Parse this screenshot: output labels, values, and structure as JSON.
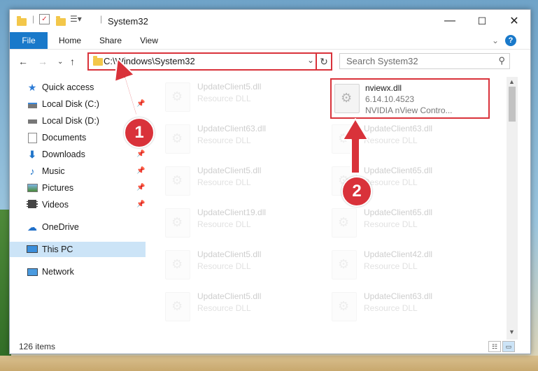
{
  "window": {
    "title": "System32",
    "controls": {
      "minimize": "—",
      "maximize": "☐",
      "close": "✕"
    }
  },
  "ribbon": {
    "tabs": [
      "File",
      "Home",
      "Share",
      "View"
    ],
    "help": "?"
  },
  "navigation": {
    "address": "C:\\Windows\\System32",
    "search_placeholder": "Search System32"
  },
  "sidebar": {
    "items": [
      {
        "label": "Quick access",
        "icon": "star-icon",
        "pinned": false
      },
      {
        "label": "Local Disk (C:)",
        "icon": "drive-icon",
        "pinned": true
      },
      {
        "label": "Local Disk (D:)",
        "icon": "drive-icon",
        "pinned": false
      },
      {
        "label": "Documents",
        "icon": "documents-icon",
        "pinned": true
      },
      {
        "label": "Downloads",
        "icon": "download-icon",
        "pinned": true
      },
      {
        "label": "Music",
        "icon": "music-icon",
        "pinned": true
      },
      {
        "label": "Pictures",
        "icon": "pictures-icon",
        "pinned": true
      },
      {
        "label": "Videos",
        "icon": "videos-icon",
        "pinned": true
      },
      {
        "label": "OneDrive",
        "icon": "cloud-icon",
        "pinned": false
      },
      {
        "label": "This PC",
        "icon": "computer-icon",
        "pinned": false,
        "selected": true
      },
      {
        "label": "Network",
        "icon": "network-icon",
        "pinned": false
      }
    ]
  },
  "files": {
    "highlighted": {
      "name": "nviewx.dll",
      "version": "6.14.10.4523",
      "description": "NVIDIA nView Contro..."
    },
    "left_column": [
      {
        "name": "UpdateClient5.dll",
        "type": "Resource DLL"
      },
      {
        "name": "UpdateClient63.dll",
        "type": "Resource DLL"
      },
      {
        "name": "UpdateClient5.dll",
        "type": "Resource DLL"
      },
      {
        "name": "UpdateClient19.dll",
        "type": "Resource DLL"
      },
      {
        "name": "UpdateClient5.dll",
        "type": "Resource DLL"
      },
      {
        "name": "UpdateClient5.dll",
        "type": "Resource DLL"
      }
    ],
    "right_column": [
      {
        "name": "UpdateClient63.dll",
        "type": "Resource DLL"
      },
      {
        "name": "UpdateClient65.dll",
        "type": "Resource DLL"
      },
      {
        "name": "UpdateClient65.dll",
        "type": "Resource DLL"
      },
      {
        "name": "UpdateClient42.dll",
        "type": "Resource DLL"
      },
      {
        "name": "UpdateClient63.dll",
        "type": "Resource DLL"
      }
    ]
  },
  "status": {
    "item_count": "126 items"
  },
  "annotations": {
    "step1": "1",
    "step2": "2",
    "color": "#d9323a"
  }
}
